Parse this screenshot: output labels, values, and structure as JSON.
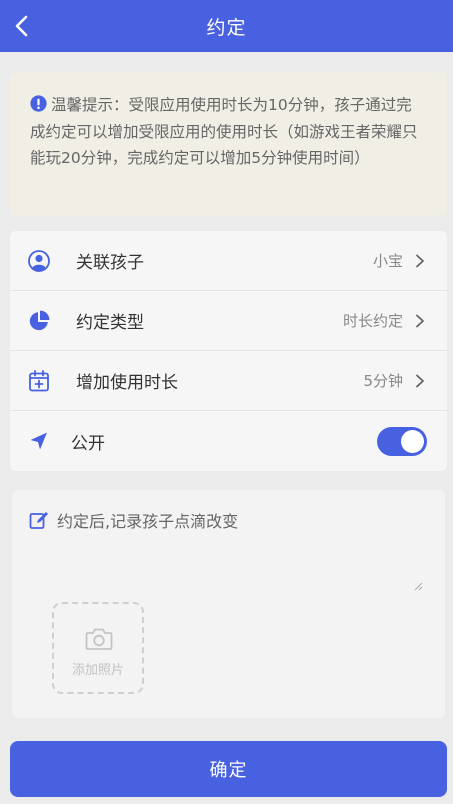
{
  "header": {
    "title": "约定"
  },
  "notice": {
    "text": "温馨提示：受限应用使用时长为10分钟，孩子通过完成约定可以增加受限应用的使用时长（如游戏王者荣耀只能玩20分钟，完成约定可以增加5分钟使用时间）"
  },
  "settings": {
    "rows": [
      {
        "label": "关联孩子",
        "value": "小宝"
      },
      {
        "label": "约定类型",
        "value": "时长约定"
      },
      {
        "label": "增加使用时长",
        "value": "5分钟"
      }
    ],
    "public_label": "公开",
    "public_on": true
  },
  "note": {
    "placeholder": "约定后,记录孩子点滴改变",
    "add_photo_label": "添加照片"
  },
  "confirm_label": "确定",
  "colors": {
    "primary": "#4861e0",
    "notice_bg": "#f1eee6"
  }
}
